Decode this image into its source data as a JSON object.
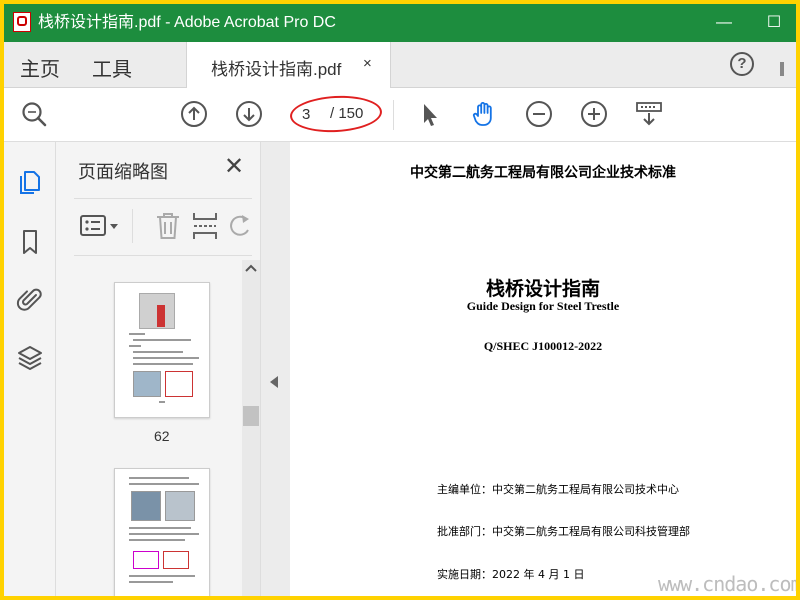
{
  "window": {
    "title": "栈桥设计指南.pdf - Adobe Acrobat Pro DC",
    "minimize": "—",
    "maximize": "☐"
  },
  "tabs": {
    "home": "主页",
    "tools": "工具",
    "document": "栈桥设计指南.pdf",
    "close": "×",
    "help": "?"
  },
  "toolbar": {
    "current_page": "3",
    "total_pages": "/ 150"
  },
  "thumbnails": {
    "title": "页面缩略图",
    "close": "✕",
    "pages": [
      {
        "number": "62"
      },
      {
        "number": ""
      }
    ]
  },
  "document": {
    "organization_standard": "中交第二航务工程局有限公司企业技术标准",
    "title_cn": "栈桥设计指南",
    "title_en": "Guide Design for Steel Trestle",
    "code": "Q/SHEC J100012-2022",
    "editor": "主编单位：中交第二航务工程局有限公司技术中心",
    "approver": "批准部门：中交第二航务工程局有限公司科技管理部",
    "date": "实施日期：2022 年 4 月 1 日"
  },
  "watermark": "www.cndao.com",
  "colors": {
    "title_bar": "#1d8d3e",
    "accent_blue": "#1473e6",
    "annotation_red": "#e02020"
  }
}
